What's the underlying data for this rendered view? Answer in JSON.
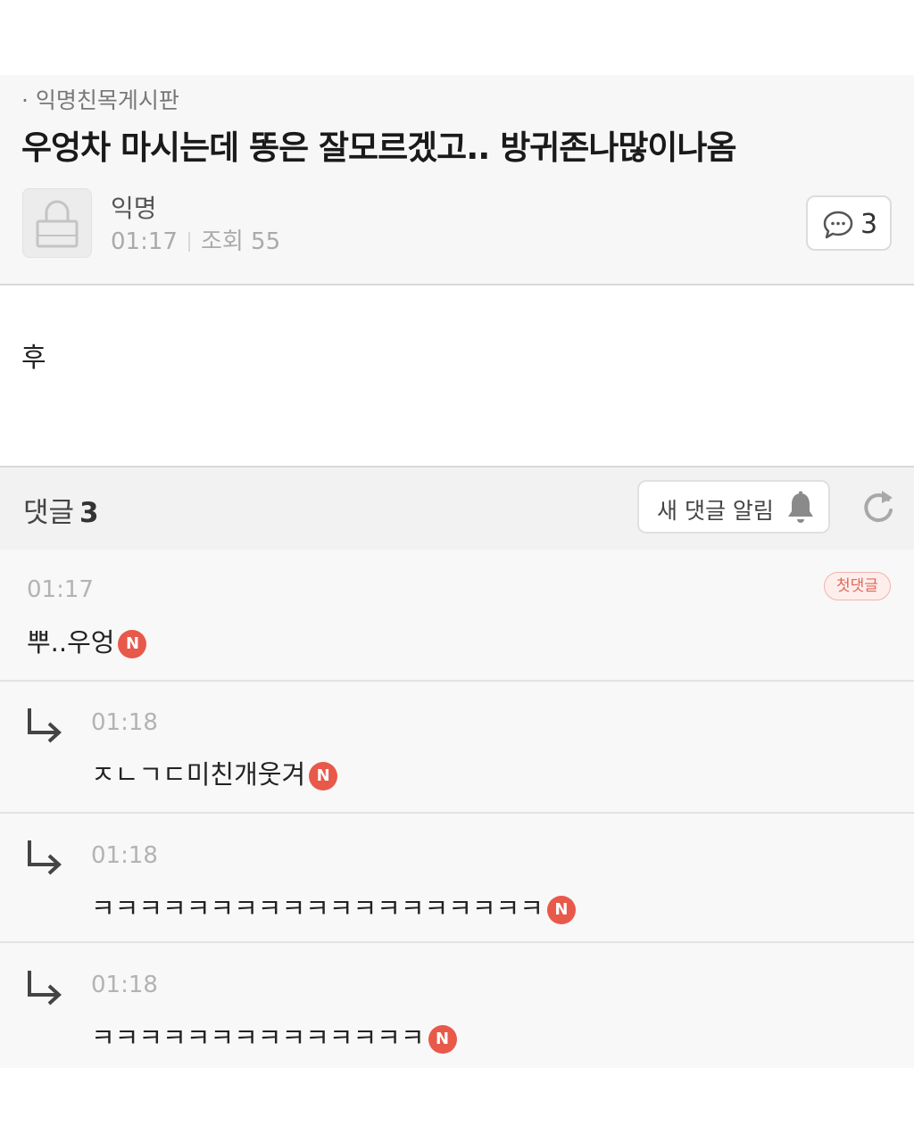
{
  "post": {
    "board_name": "· 익명친목게시판",
    "title": "우엉차 마시는데 똥은 잘모르겠고.. 방귀존나많이나옴",
    "author": "익명",
    "time": "01:17",
    "views": "조회 55",
    "comment_count": "3",
    "body": "후"
  },
  "comments_section": {
    "label": "댓글",
    "count": "3",
    "notify_label": "새 댓글 알림"
  },
  "comments": [
    {
      "time": "01:17",
      "text": "뿌..우엉",
      "badge": "N",
      "first_label": "첫댓글"
    },
    {
      "time": "01:18",
      "text": "ㅈㄴㄱㄷ미친개웃겨",
      "badge": "N"
    },
    {
      "time": "01:18",
      "text": "ㅋㅋㅋㅋㅋㅋㅋㅋㅋㅋㅋㅋㅋㅋㅋㅋㅋㅋㅋ",
      "badge": "N"
    },
    {
      "time": "01:18",
      "text": "ㅋㅋㅋㅋㅋㅋㅋㅋㅋㅋㅋㅋㅋㅋ",
      "badge": "N"
    }
  ],
  "icons": {
    "avatar": "lock-icon",
    "comment": "speech-bubble-icon",
    "notify": "bell-icon",
    "refresh": "refresh-icon",
    "reply": "reply-arrow-icon"
  },
  "colors": {
    "new_badge": "#e8594a",
    "first_comment_badge": "#e0685a"
  }
}
